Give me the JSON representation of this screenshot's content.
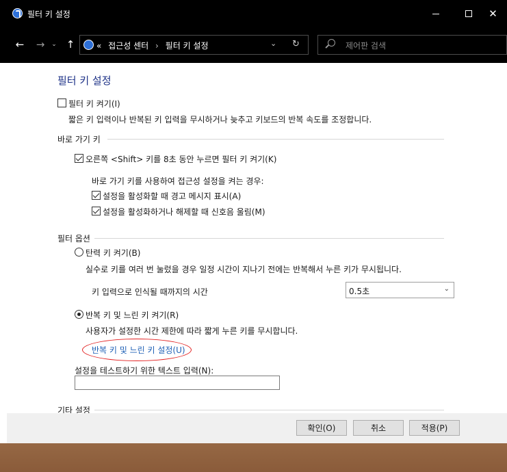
{
  "window": {
    "title": "필터 키 설정",
    "minimize_glyph": "",
    "maximize_glyph": "",
    "close_glyph": "✕"
  },
  "nav": {
    "back_glyph": "←",
    "forward_glyph": "→",
    "history_glyph": "⌄",
    "up_glyph": "↑",
    "breadcrumb_prefix": "«",
    "breadcrumb": [
      "접근성 센터",
      "필터 키 설정"
    ],
    "breadcrumb_sep": "›",
    "dropdown_glyph": "⌄",
    "refresh_glyph": "↻",
    "search_placeholder": "제어판 검색"
  },
  "page": {
    "title": "필터 키 설정",
    "filter_keys_checkbox": {
      "label": "필터 키 켜기(I)",
      "checked": false
    },
    "filter_keys_desc": "짧은 키 입력이나 반복된 키 입력을 무시하거나 늦추고 키보드의 반복 속도를 조정합니다.",
    "shortcut_section": {
      "heading": "바로 가기 키",
      "right_shift": {
        "label": "오른쪽 <Shift> 키를 8초 동안 누르면 필터 키 켜기(K)",
        "checked": true
      },
      "when_using": "바로 가기 키를 사용하여 접근성 설정을 켜는 경우:",
      "warning": {
        "label": "설정을 활성화할 때 경고 메시지 표시(A)",
        "checked": true
      },
      "sound": {
        "label": "설정을 활성화하거나 해제할 때 신호음 울림(M)",
        "checked": true
      }
    },
    "filter_options": {
      "heading": "필터 옵션",
      "bounce_keys": {
        "label": "탄력 키 켜기(B)",
        "checked": false
      },
      "bounce_desc": "실수로 키를 여러 번 눌렀을 경우 일정 시간이 지나기 전에는 반복해서 누른 키가 무시됩니다.",
      "wait_label": "키 입력으로 인식될 때까지의 시간",
      "wait_value": "0.5초",
      "repeat_slow": {
        "label": "반복 키 및 느린 키 켜기(R)",
        "checked": true
      },
      "repeat_desc": "사용자가 설정한 시간 제한에 따라 짧게 누른 키를 무시합니다.",
      "setup_link": "반복 키 및 느린 키 설정(U)"
    },
    "test_input": {
      "label": "설정을 테스트하기 위한 텍스트 입력(N):",
      "value": ""
    },
    "other_settings": {
      "heading": "기타 설정"
    }
  },
  "footer": {
    "ok": "확인(O)",
    "cancel": "취소",
    "apply": "적용(P)"
  },
  "colors": {
    "title_bar": "#000000",
    "heading_blue": "#1e3287",
    "link_blue": "#1d5fb5",
    "annotation_red": "#e21e1e"
  }
}
